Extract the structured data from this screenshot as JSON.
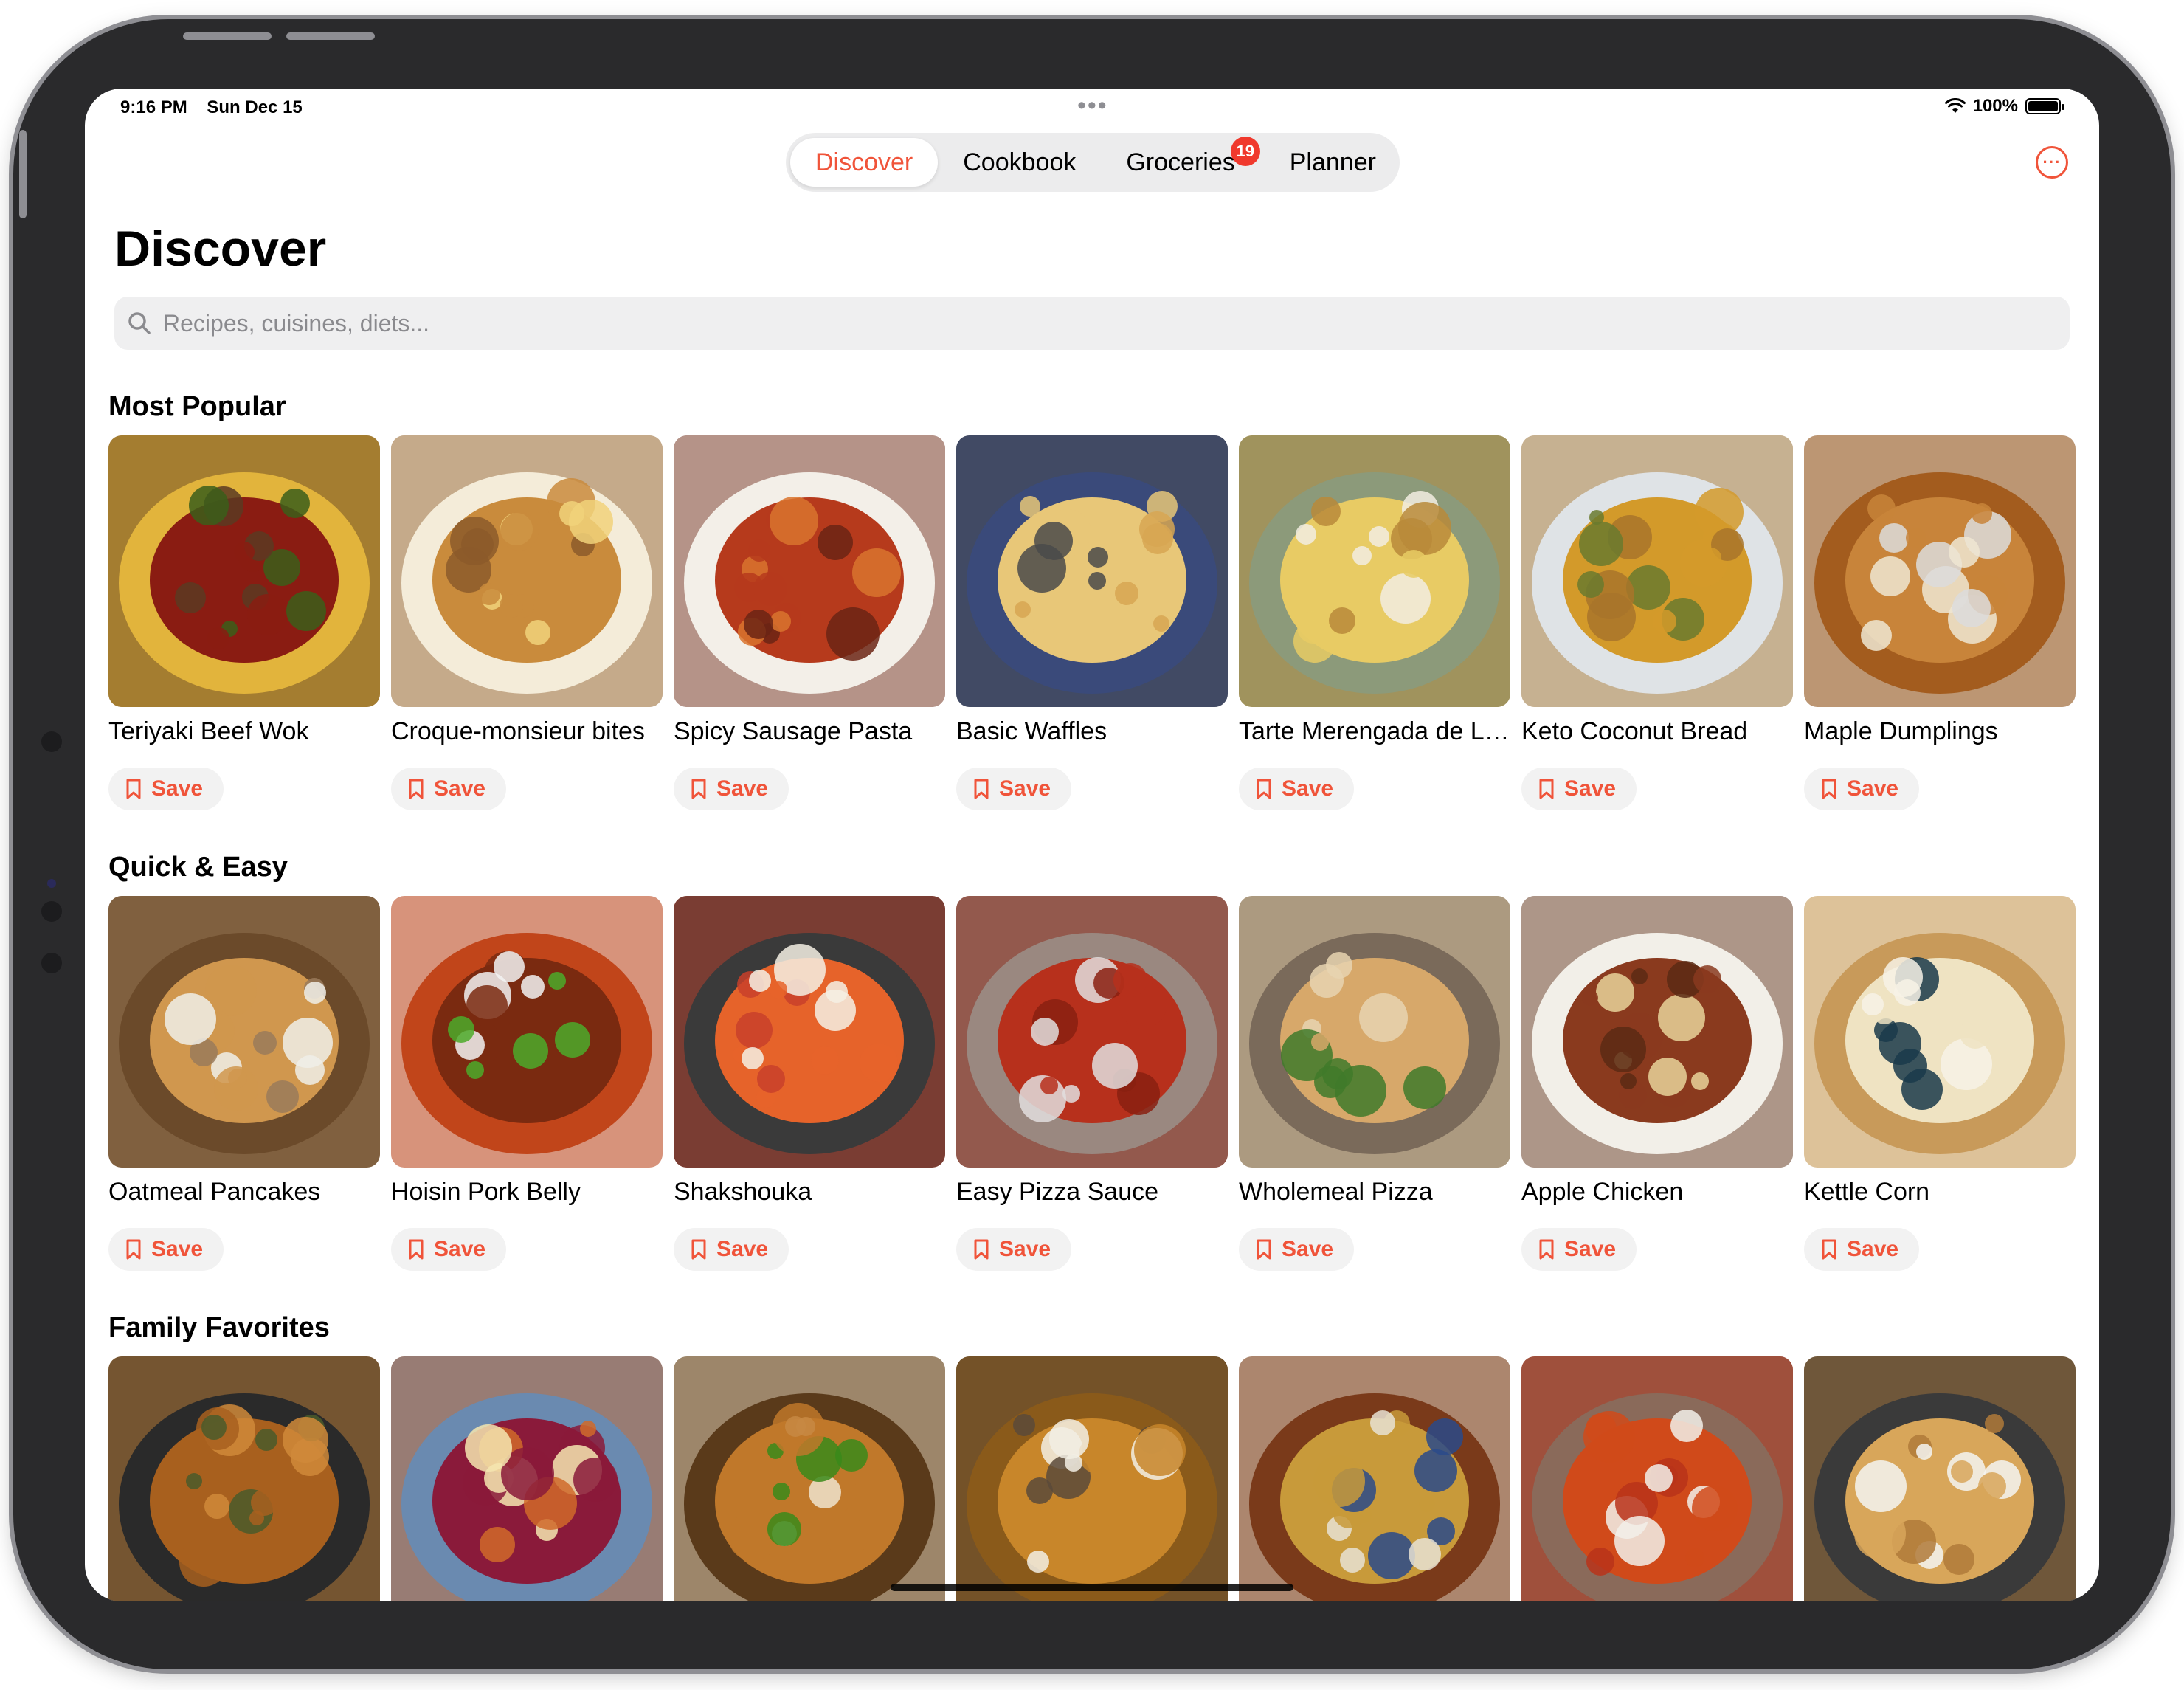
{
  "status": {
    "time": "9:16 PM",
    "date": "Sun Dec 15",
    "battery": "100%",
    "battery_level": 1.0
  },
  "nav": {
    "tabs": [
      {
        "label": "Discover",
        "active": true
      },
      {
        "label": "Cookbook",
        "active": false
      },
      {
        "label": "Groceries",
        "active": false,
        "badge": "19"
      },
      {
        "label": "Planner",
        "active": false
      }
    ],
    "more_icon": "ellipsis-circle-icon"
  },
  "page": {
    "title": "Discover"
  },
  "search": {
    "placeholder": "Recipes, cuisines, diets...",
    "icon": "magnifying-glass-icon"
  },
  "colors": {
    "accent": "#f0543a",
    "badge": "#f0392d",
    "chip_bg": "#f2f2f2"
  },
  "sections": [
    {
      "title": "Most Popular",
      "items": [
        {
          "name": "Teriyaki Beef Wok",
          "save": "Save",
          "colors": [
            "#8a1c12",
            "#3b5e1a",
            "#e2b43c",
            "#5a3a22"
          ]
        },
        {
          "name": "Croque-monsieur bites",
          "save": "Save",
          "colors": [
            "#c98b3c",
            "#f1d27a",
            "#f4ecd9",
            "#8c5a2a"
          ]
        },
        {
          "name": "Spicy Sausage Pasta",
          "save": "Save",
          "colors": [
            "#b63a1c",
            "#d9742e",
            "#f3efe8",
            "#6b2414"
          ]
        },
        {
          "name": "Basic Waffles",
          "save": "Save",
          "colors": [
            "#e8c778",
            "#d7a652",
            "#3a4a7a",
            "#4a4a4a"
          ]
        },
        {
          "name": "Tarte Merengada de Limón",
          "save": "Save",
          "colors": [
            "#e8cb64",
            "#f2ede2",
            "#8c9a7a",
            "#b88a3a"
          ]
        },
        {
          "name": "Keto Coconut Bread",
          "save": "Save",
          "colors": [
            "#d39a2a",
            "#6a7a2e",
            "#dfe3e6",
            "#a8742a"
          ]
        },
        {
          "name": "Maple Dumplings",
          "save": "Save",
          "colors": [
            "#c8843a",
            "#efe6d2",
            "#a35c1e",
            "#dcdcdc"
          ]
        }
      ]
    },
    {
      "title": "Quick & Easy",
      "items": [
        {
          "name": "Oatmeal Pancakes",
          "save": "Save",
          "colors": [
            "#d0974e",
            "#f0eee9",
            "#6b4a2a",
            "#9a7a5a"
          ]
        },
        {
          "name": "Hoisin Pork Belly",
          "save": "Save",
          "colors": [
            "#7a2a10",
            "#4caa2a",
            "#c1451a",
            "#f2f2f2"
          ]
        },
        {
          "name": "Shakshouka",
          "save": "Save",
          "colors": [
            "#e6632a",
            "#f4f0e4",
            "#3a3a3a",
            "#c8402a"
          ]
        },
        {
          "name": "Easy Pizza Sauce",
          "save": "Save",
          "colors": [
            "#b7301c",
            "#e2dede",
            "#9a8880",
            "#8a2010"
          ]
        },
        {
          "name": "Wholemeal Pizza",
          "save": "Save",
          "colors": [
            "#d7a86a",
            "#3f7a2a",
            "#7a6a5a",
            "#e8d4b0"
          ]
        },
        {
          "name": "Apple Chicken",
          "save": "Save",
          "colors": [
            "#8a3a1e",
            "#e8d49a",
            "#f2efe8",
            "#5a2a14"
          ]
        },
        {
          "name": "Kettle Corn",
          "save": "Save",
          "colors": [
            "#efe3c2",
            "#1a3a4a",
            "#c89a5a",
            "#f7f2e6"
          ]
        }
      ]
    },
    {
      "title": "Family Favorites",
      "items": [
        {
          "name": "",
          "save": "",
          "colors": [
            "#a8601e",
            "#4a5a2a",
            "#2a2a2a",
            "#d08a3a"
          ]
        },
        {
          "name": "",
          "save": "",
          "colors": [
            "#8a1a3a",
            "#f4e6b0",
            "#6a8ab0",
            "#d06a2a"
          ]
        },
        {
          "name": "",
          "save": "",
          "colors": [
            "#c0782a",
            "#3a8a1a",
            "#5a3a1a",
            "#efe3cc"
          ]
        },
        {
          "name": "",
          "save": "",
          "colors": [
            "#c8862a",
            "#f2eee4",
            "#8a5a1a",
            "#5a4a3a"
          ]
        },
        {
          "name": "",
          "save": "",
          "colors": [
            "#c89a3a",
            "#2a4a8a",
            "#7a3a1a",
            "#e8e2d4"
          ]
        },
        {
          "name": "",
          "save": "",
          "colors": [
            "#d04a1a",
            "#f2f0ea",
            "#8a6a5a",
            "#b8321a"
          ]
        },
        {
          "name": "",
          "save": "",
          "colors": [
            "#d8a65a",
            "#f4f4f2",
            "#3a3a3a",
            "#b07a3a"
          ]
        }
      ]
    }
  ]
}
